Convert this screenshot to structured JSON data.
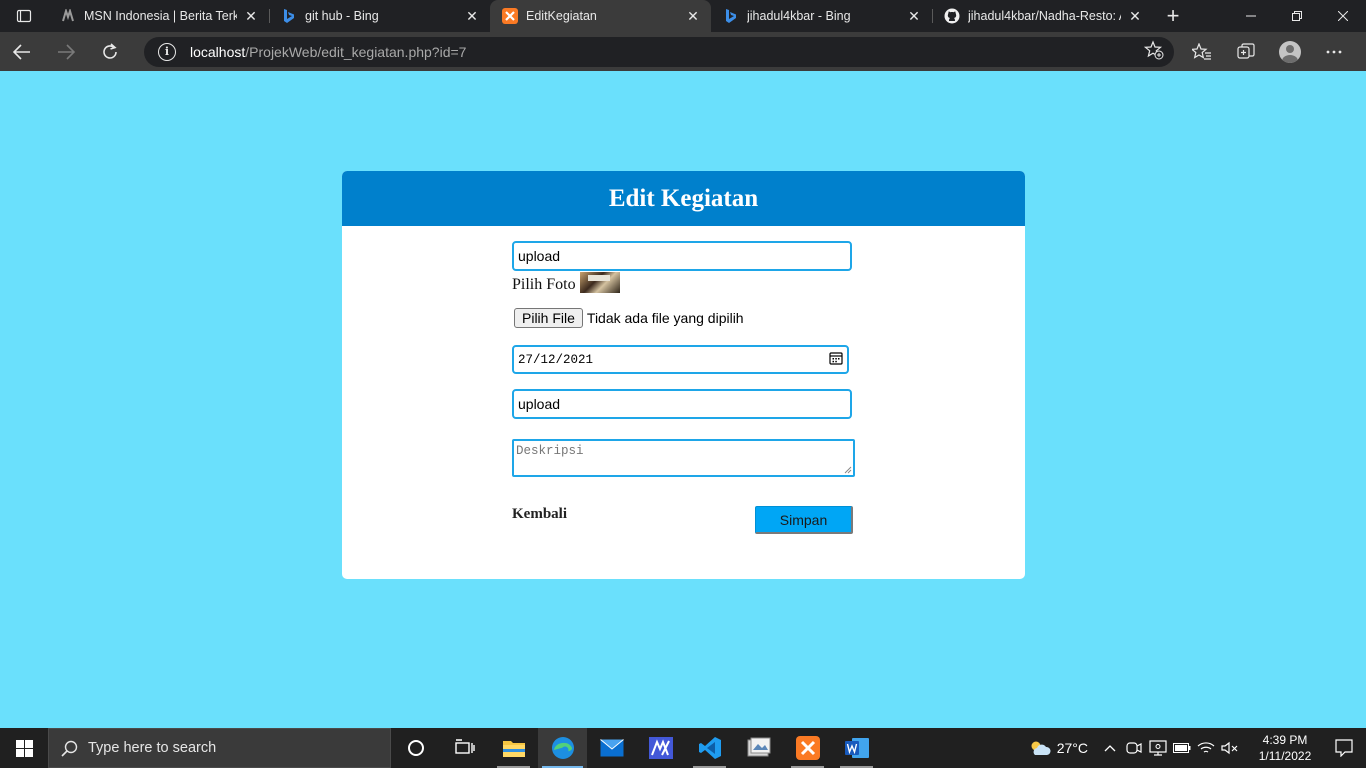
{
  "browser": {
    "tabs": [
      {
        "title": "MSN Indonesia | Berita Terkini",
        "icon": "msn-icon",
        "active": false
      },
      {
        "title": "git hub - Bing",
        "icon": "bing-icon",
        "active": false
      },
      {
        "title": "EditKegiatan",
        "icon": "xampp-icon",
        "active": true
      },
      {
        "title": "jihadul4kbar - Bing",
        "icon": "bing-icon",
        "active": false
      },
      {
        "title": "jihadul4kbar/Nadha-Resto: Ap",
        "icon": "github-icon",
        "active": false
      }
    ],
    "close_glyph": "✕",
    "new_tab_glyph": "+",
    "url_host": "localhost",
    "url_path": "/ProjekWeb/edit_kegiatan.php?id=7",
    "info_glyph": "i"
  },
  "page": {
    "background": "#6ae0fc",
    "header_color": "#0080cc",
    "title": "Edit Kegiatan",
    "name_value": "upload",
    "photo_label": "Pilih Foto",
    "file_button": "Pilih File",
    "file_status": "Tidak ada file yang dipilih",
    "date_value": "27/12/2021",
    "place_value": "upload",
    "description_placeholder": "Deskripsi",
    "back_link": "Kembali",
    "save_button": "Simpan",
    "save_color": "#00a6f5"
  },
  "taskbar": {
    "search_placeholder": "Type here to search",
    "pinned": [
      "task-view",
      "file-explorer",
      "edge",
      "mail",
      "media-app",
      "vscode",
      "gallery",
      "xampp",
      "word"
    ],
    "temperature": "27°C",
    "time": "4:39 PM",
    "date": "1/11/2022"
  }
}
